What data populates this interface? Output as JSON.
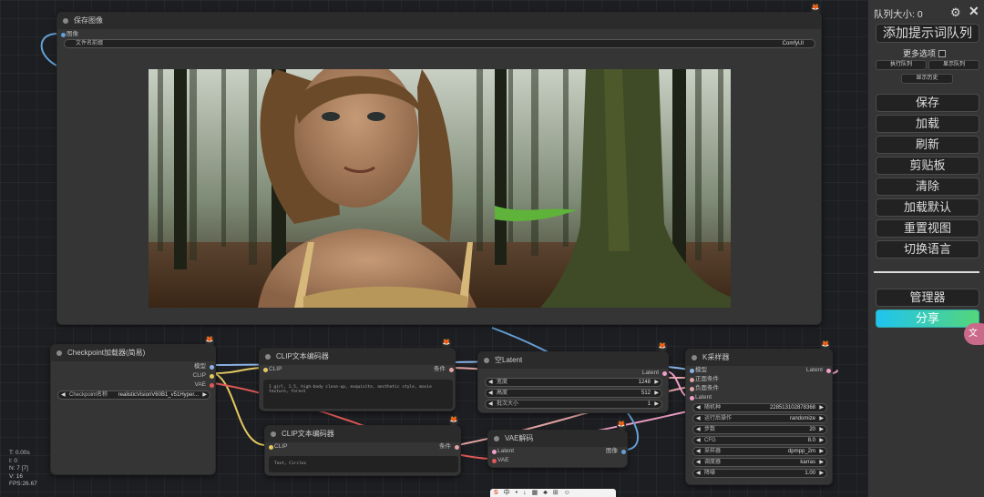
{
  "save_node": {
    "title": "保存图像",
    "input_label": "图像",
    "prefix_label": "文件名前缀",
    "prefix_value": "ComfyUI"
  },
  "checkpoint_node": {
    "title": "Checkpoint加载器(简易)",
    "outputs": [
      "模型",
      "CLIP",
      "VAE"
    ],
    "widget_label": "Checkpoint名称",
    "widget_value": "realisticVisionV60B1_v51Hyper..."
  },
  "clip_pos_node": {
    "title": "CLIP文本编码器",
    "input": "CLIP",
    "output": "条件",
    "text": "1 girl, 1.5, high-body close-up, exquisite, aesthetic style, movie texture, forest"
  },
  "clip_neg_node": {
    "title": "CLIP文本编码器",
    "input": "CLIP",
    "output": "条件",
    "text": "Text, Circles"
  },
  "latent_node": {
    "title": "空Latent",
    "output": "Latent",
    "widgets": [
      {
        "label": "宽度",
        "value": "1248"
      },
      {
        "label": "高度",
        "value": "512"
      },
      {
        "label": "批次大小",
        "value": "1"
      }
    ]
  },
  "vae_node": {
    "title": "VAE解码",
    "inputs": [
      "Latent",
      "VAE"
    ],
    "output": "图像"
  },
  "ksampler_node": {
    "title": "K采样器",
    "inputs": [
      "模型",
      "正面条件",
      "负面条件",
      "Latent"
    ],
    "output": "Latent",
    "widgets": [
      {
        "label": "随机种",
        "value": "228513102878368"
      },
      {
        "label": "运行后操作",
        "value": "randomize"
      },
      {
        "label": "步数",
        "value": "20"
      },
      {
        "label": "CFG",
        "value": "8.0"
      },
      {
        "label": "采样器",
        "value": "dpmpp_2m"
      },
      {
        "label": "调度器",
        "value": "karras"
      },
      {
        "label": "降噪",
        "value": "1.00"
      }
    ]
  },
  "sidebar": {
    "queue_size": "队列大小: 0",
    "queue_button": "添加提示词队列",
    "more_options": "更多选项",
    "small_buttons": [
      "执行队列",
      "显示队列"
    ],
    "history_button": "显示历史",
    "buttons": [
      "保存",
      "加载",
      "刷新",
      "剪贴板",
      "清除",
      "加载默认",
      "重置视图",
      "切换语言"
    ],
    "manager_button": "管理器",
    "share_button": "分享",
    "colors": {
      "share_gradient_start": "#1fc4f0",
      "share_gradient_end": "#55d67a"
    }
  },
  "stats": [
    "T: 0.00s",
    "I: 0",
    "N: 7 [7]",
    "V: 16",
    "FPS:26.67"
  ],
  "taskbar": {
    "items": [
      "中",
      "•",
      "↓",
      "▦",
      "♣",
      "⊞",
      "☺"
    ]
  }
}
